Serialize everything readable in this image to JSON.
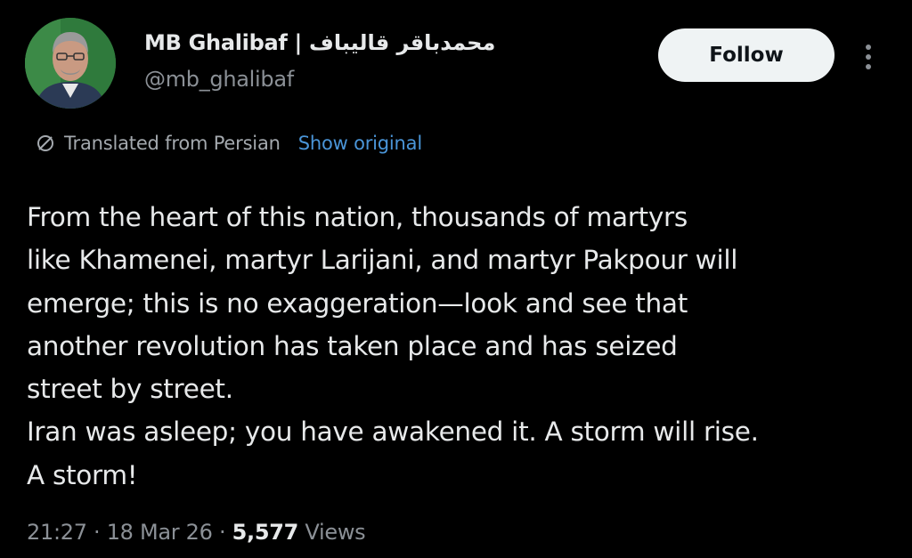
{
  "author": {
    "display_name": "MB Ghalibaf",
    "separator": "|",
    "persian_name": "محمدباقر قالیباف",
    "handle": "@mb_ghalibaf"
  },
  "actions": {
    "follow_label": "Follow"
  },
  "translation": {
    "notice": "Translated from Persian",
    "show_original_label": "Show original"
  },
  "tweet": {
    "lines": [
      "From the heart of this nation, thousands of martyrs",
      "like Khamenei, martyr Larijani, and martyr Pakpour will",
      "emerge; this is no exaggeration—look and see that",
      "another revolution has taken place and has seized",
      "street by street.",
      "Iran was asleep; you have awakened it. A storm will rise.",
      "A storm!"
    ]
  },
  "meta": {
    "time": "21:27",
    "dot": "·",
    "date": "18 Mar 26",
    "views_count": "5,577",
    "views_label": "Views"
  },
  "colors": {
    "background": "#000000",
    "text_primary": "#e7e9ea",
    "text_secondary": "#8b9096",
    "link": "#4a95d8",
    "follow_bg": "#eff3f4"
  },
  "icons": {
    "translate": "translate-icon",
    "more": "more-dots-icon"
  }
}
